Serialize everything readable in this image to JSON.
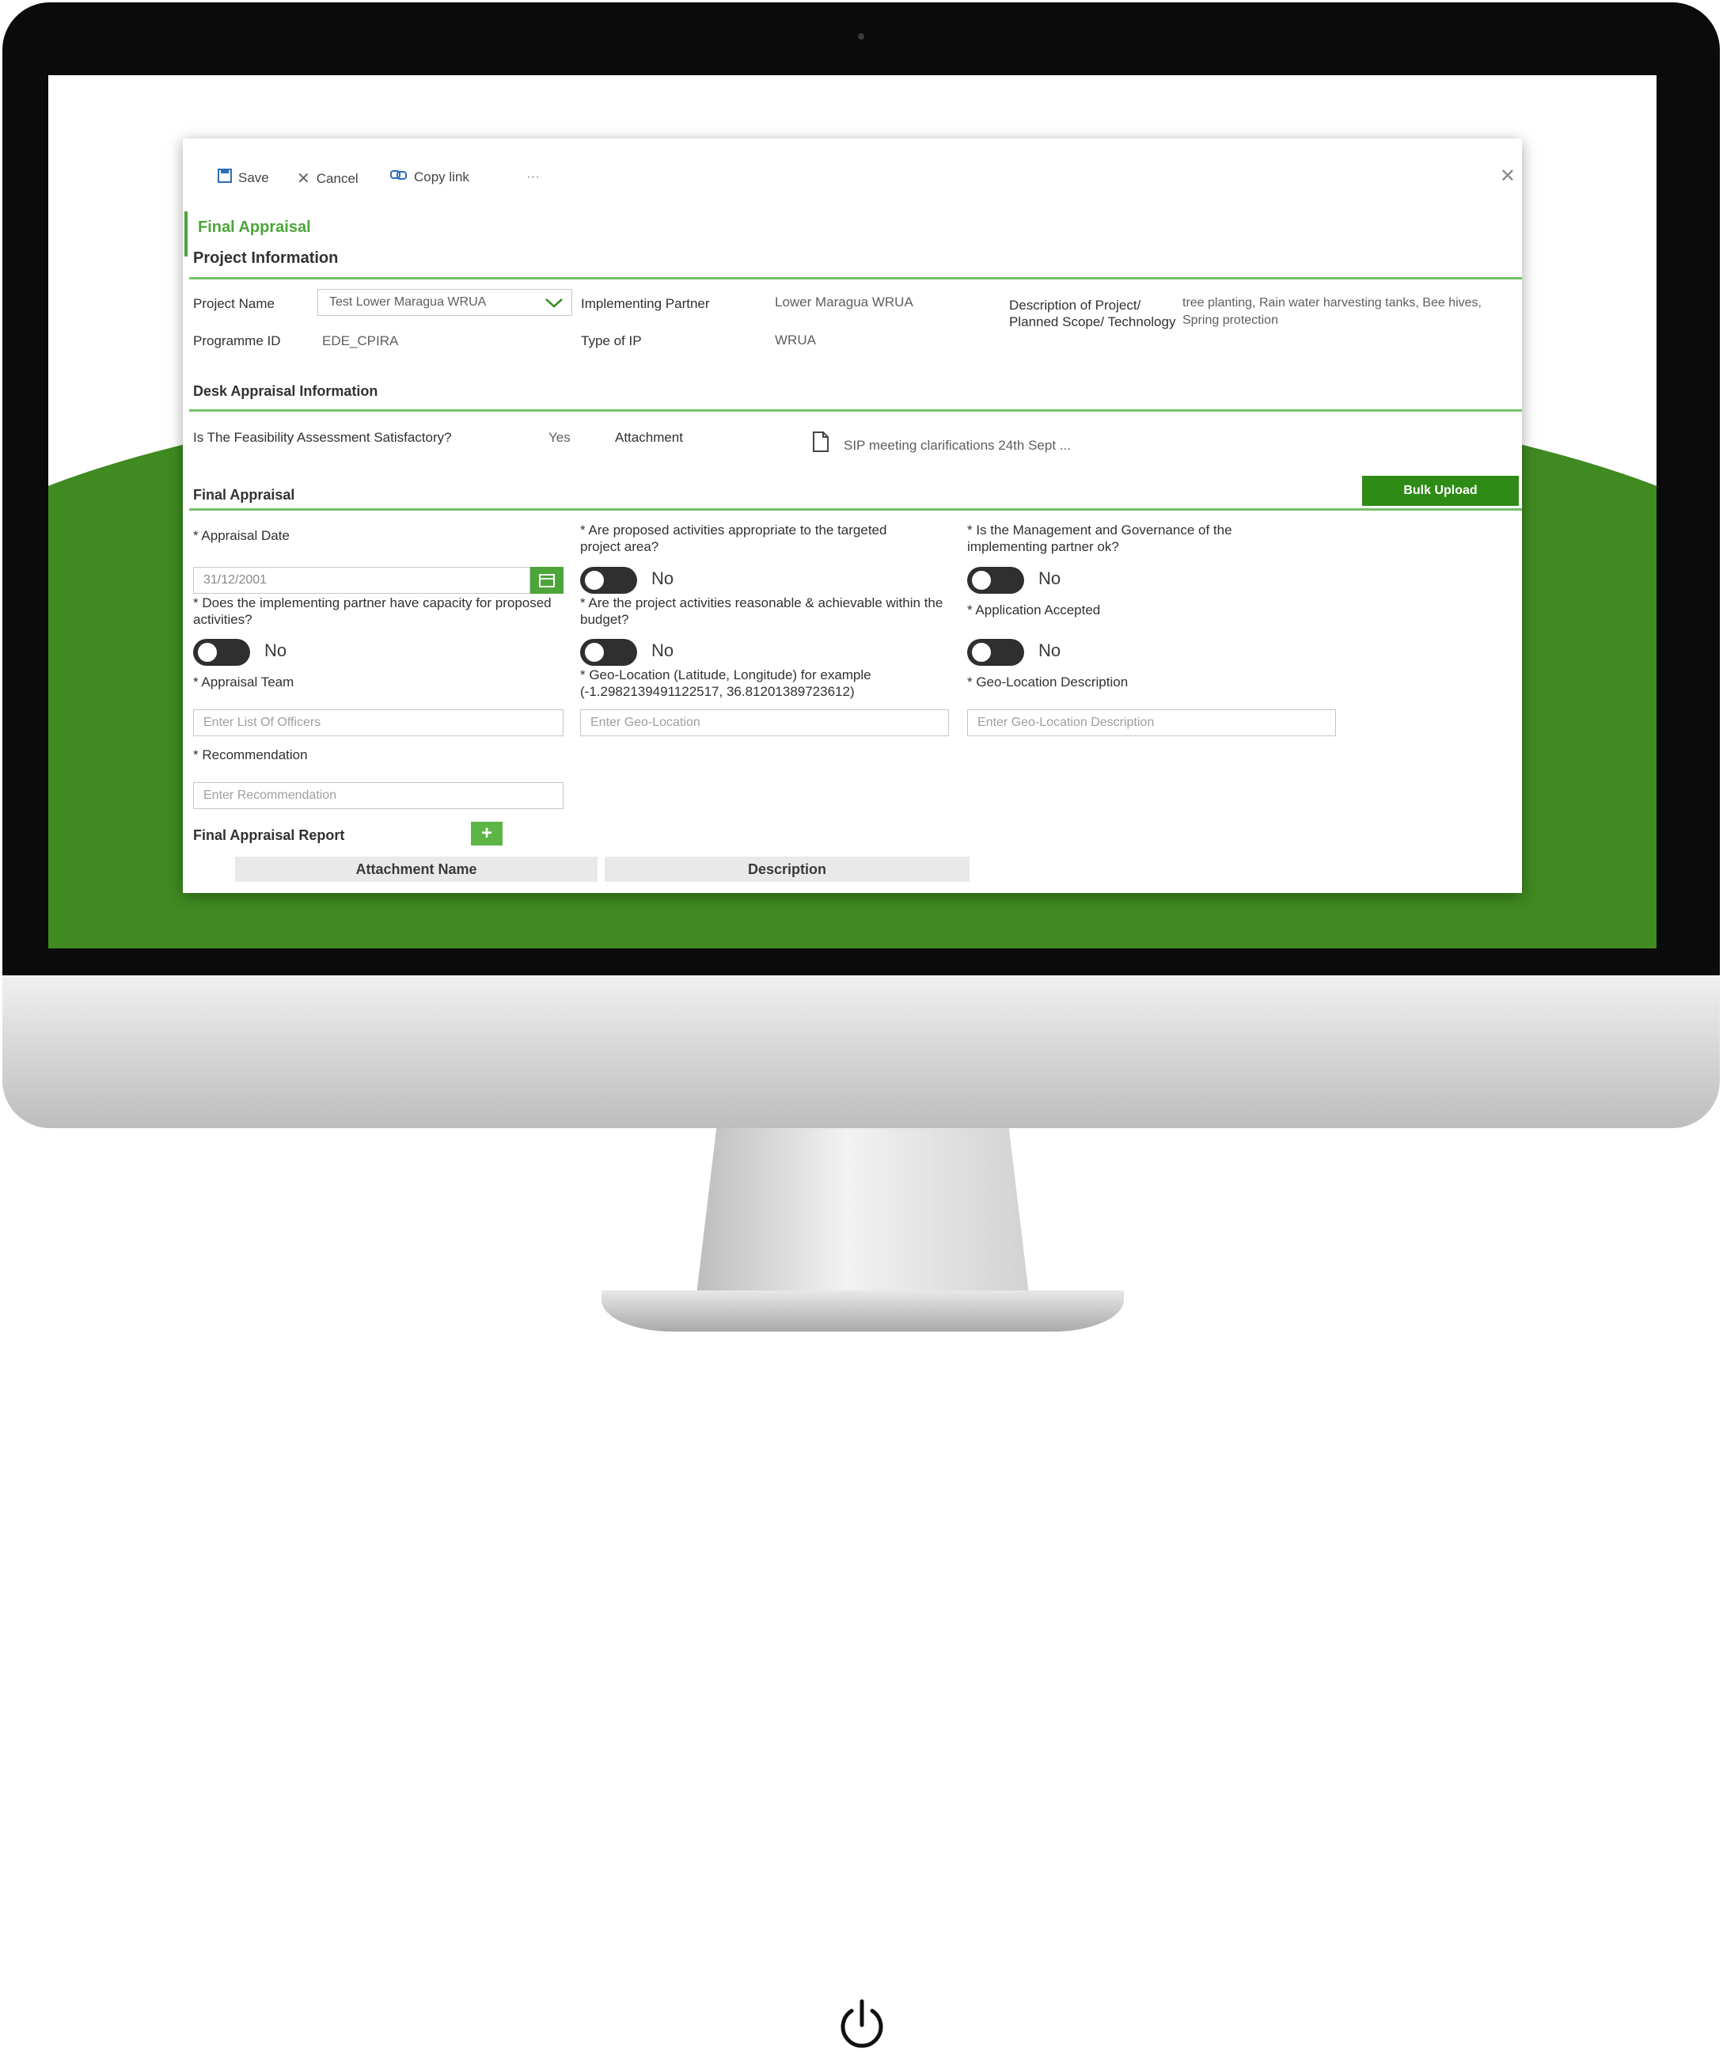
{
  "toolbar": {
    "save_label": "Save",
    "cancel_label": "Cancel",
    "copy_link_label": "Copy link",
    "more_label": "···",
    "close_label": "✕"
  },
  "form_title": "Final Appraisal",
  "project_info": {
    "header": "Project Information",
    "project_name_label": "Project Name",
    "project_name_value": "Test Lower Maragua WRUA",
    "implementing_partner_label": "Implementing Partner",
    "implementing_partner_value": "Lower Maragua WRUA",
    "description_label": "Description of Project/ Planned Scope/ Technology",
    "description_value": "tree planting, Rain water harvesting tanks, Bee hives, Spring protection",
    "programme_id_label": "Programme ID",
    "programme_id_value": "EDE_CPIRA",
    "type_of_ip_label": "Type of IP",
    "type_of_ip_value": "WRUA"
  },
  "desk_appraisal": {
    "header": "Desk Appraisal Information",
    "feasibility_label": "Is The Feasibility Assessment Satisfactory?",
    "feasibility_value": "Yes",
    "attachment_label": "Attachment",
    "attachment_file": "SIP meeting clarifications 24th Sept ..."
  },
  "final_appraisal": {
    "header": "Final Appraisal",
    "bulk_upload_label": "Bulk Upload",
    "appraisal_date_label": "* Appraisal Date",
    "appraisal_date_value": "31/12/2001",
    "q_activities_appropriate": "* Are proposed activities appropriate to the targeted project area?",
    "q_management_ok": "* Is the Management and Governance of the implementing partner ok?",
    "q_capacity": "* Does the implementing partner have capacity for proposed activities?",
    "q_reasonable": "* Are the project activities reasonable & achievable within the budget?",
    "q_application_accepted": "* Application Accepted",
    "toggle_no": "No",
    "appraisal_team_label": "* Appraisal Team",
    "appraisal_team_placeholder": "Enter List Of Officers",
    "geo_location_label": "* Geo-Location (Latitude, Longitude) for example (-1.2982139491122517, 36.81201389723612)",
    "geo_location_placeholder": "Enter Geo-Location",
    "geo_desc_label": "* Geo-Location Description",
    "geo_desc_placeholder": "Enter Geo-Location Description",
    "recommendation_label": "* Recommendation",
    "recommendation_placeholder": "Enter Recommendation",
    "report_label": "Final Appraisal Report",
    "add_label": "+",
    "table_headers": [
      "Attachment Name",
      "Description"
    ]
  },
  "colors": {
    "brand_green": "#3f8a21",
    "accent_green": "#4ca538",
    "button_green": "#2e8b16",
    "toggle_off": "#2f2f2f"
  },
  "icons": [
    "save-icon",
    "cancel-icon",
    "copy-link-icon",
    "more-icon",
    "close-icon",
    "chevron-down-icon",
    "calendar-icon",
    "document-icon",
    "power-icon"
  ]
}
